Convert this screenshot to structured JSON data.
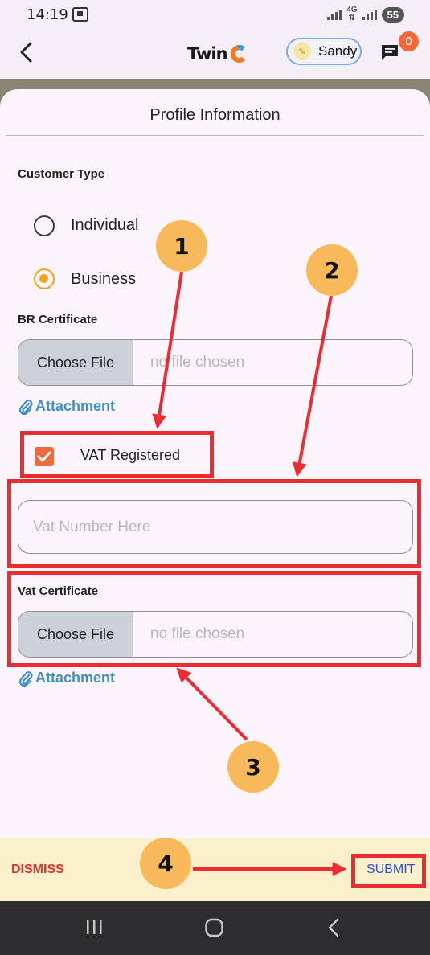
{
  "status_bar": {
    "time": "14:19",
    "network": "4G",
    "battery": "55"
  },
  "header": {
    "logo_text": "Twin",
    "user_name": "Sandy",
    "notification_count": "0"
  },
  "sheet": {
    "title": "Profile Information",
    "customer_type": {
      "label": "Customer Type",
      "options": [
        "Individual",
        "Business"
      ],
      "selected": "Business"
    },
    "br_certificate": {
      "label": "BR Certificate",
      "choose_label": "Choose File",
      "status": "no file chosen",
      "attachment_label": "Attachment"
    },
    "vat_registered": {
      "label": "VAT Registered",
      "checked": true
    },
    "vat_number": {
      "placeholder": "Vat Number Here"
    },
    "vat_certificate": {
      "label": "Vat Certificate",
      "choose_label": "Choose File",
      "status": "no file chosen",
      "attachment_label": "Attachment"
    }
  },
  "footer": {
    "dismiss_label": "DISMISS",
    "submit_label": "SUBMIT"
  },
  "annotations": {
    "markers": [
      "1",
      "2",
      "3",
      "4"
    ],
    "color": "#ec2c33",
    "marker_color": "#f7b95a"
  },
  "colors": {
    "accent_radio": "#f2a514",
    "checkbox": "#ec6a3c",
    "attachment_link": "#3f8fc6",
    "dismiss": "#e0322b",
    "submit": "#2d4fd0"
  }
}
